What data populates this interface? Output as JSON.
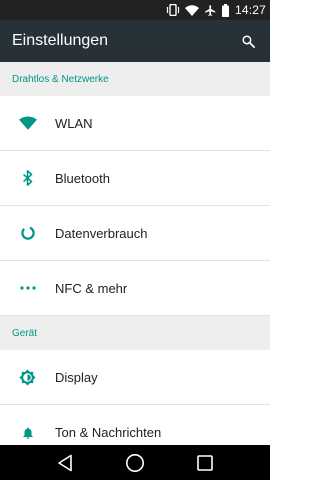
{
  "status_bar": {
    "time": "14:27",
    "icons": [
      "vibrate-icon",
      "wifi-signal-icon",
      "airplane-mode-icon",
      "battery-icon"
    ]
  },
  "app_bar": {
    "title": "Einstellungen",
    "search_icon": "search-icon"
  },
  "sections": [
    {
      "header": "Drahtlos & Netzwerke",
      "items": [
        {
          "label": "WLAN",
          "icon": "wifi-icon"
        },
        {
          "label": "Bluetooth",
          "icon": "bluetooth-icon"
        },
        {
          "label": "Datenverbrauch",
          "icon": "data-usage-icon"
        },
        {
          "label": "NFC & mehr",
          "icon": "more-icon"
        }
      ]
    },
    {
      "header": "Gerät",
      "items": [
        {
          "label": "Display",
          "icon": "brightness-icon"
        },
        {
          "label": "Ton & Nachrichten",
          "icon": "bell-icon"
        }
      ]
    }
  ],
  "nav_bar": {
    "buttons": [
      "back-icon",
      "home-icon",
      "recents-icon"
    ]
  },
  "colors": {
    "accent": "#009688",
    "app_bar": "#263238",
    "status_bar": "#222222",
    "section_bg": "#eeeeee"
  }
}
